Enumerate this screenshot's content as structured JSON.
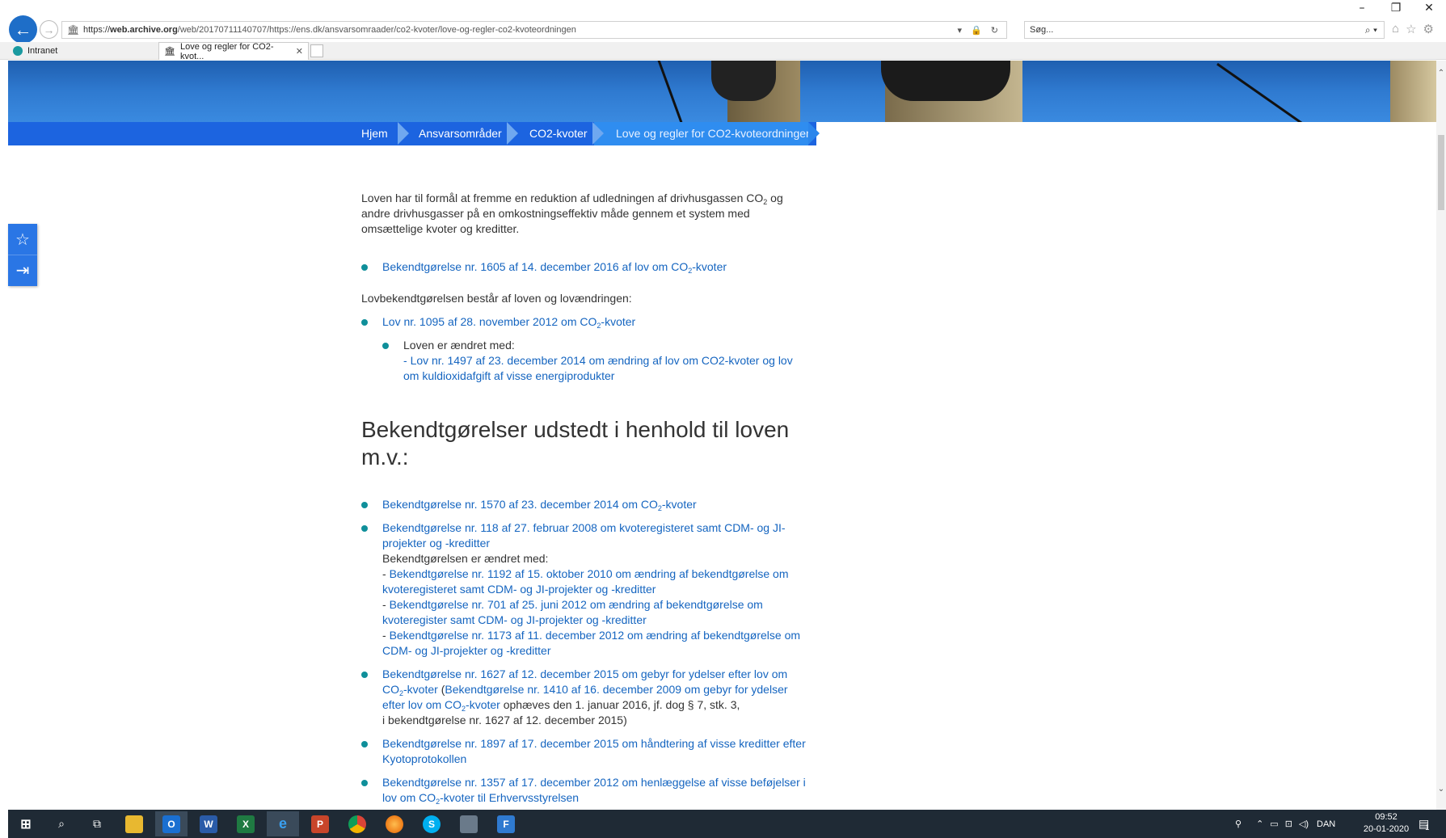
{
  "browser": {
    "url": "https://web.archive.org/web/20170711140707/https://ens.dk/ansvarsomraader/co2-kvoter/love-og-regler-co2-kvoteordningen",
    "url_host": "web.archive.org",
    "url_prefix": "https://",
    "url_rest": "/web/20170711140707/https://ens.dk/ansvarsomraader/co2-kvoter/love-og-regler-co2-kvoteordningen",
    "search_placeholder": "Søg...",
    "tabs": [
      {
        "label": "Intranet"
      },
      {
        "label": "Love og regler for CO2-kvot..."
      }
    ]
  },
  "breadcrumb": [
    {
      "label": "Hjem"
    },
    {
      "label": "Ansvarsområder"
    },
    {
      "label": "CO2-kvoter"
    },
    {
      "label": "Love og regler for CO2-kvoteordningen"
    }
  ],
  "content": {
    "intro_a": "Loven har til formål at fremme en reduktion af udledningen af drivhusgassen CO",
    "intro_b": " og andre drivhusgasser på en omkostningseffektiv måde gennem et system med omsættelige kvoter og kreditter.",
    "sub2": "2",
    "link1_a": "Bekendtgørelse nr. 1605 af 14. december 2016 af lov om CO",
    "link1_b": "-kvoter",
    "lovbek_text": "Lovbekendtgørelsen består af loven og lovændringen:",
    "link2_a": "Lov nr. 1095 af 28. november 2012 om CO",
    "link2_b": "-kvoter",
    "changed_label": "Loven er ændret med:",
    "dash": "- ",
    "link3": "Lov nr. 1497 af 23. december 2014 om ændring af lov om CO2-kvoter og lov om kuldioxidafgift af visse energiprodukter",
    "heading": "Bekendtgørelser udstedt i henhold til loven m.v.:",
    "b1_a": "Bekendtgørelse nr. 1570 af 23. december 2014 om CO",
    "b1_b": "-kvoter",
    "b2": "Bekendtgørelse nr. 118 af 27. februar 2008 om kvoteregisteret samt CDM- og JI-projekter og -kreditter",
    "b2_changed": "Bekendtgørelsen er ændret med:",
    "b2_c1": "Bekendtgørelse nr. 1192 af 15. oktober 2010 om ændring af bekendtgørelse om kvoteregisteret samt CDM- og JI-projekter og -kreditter",
    "b2_c2": "Bekendtgørelse nr. 701 af 25. juni 2012 om ændring af bekendtgørelse om kvoteregister samt CDM- og JI-projekter og -kreditter",
    "b2_c3": "Bekendtgørelse nr. 1173 af 11. december 2012 om ændring af bekendtgørelse om CDM- og JI-projekter og -kreditter",
    "b3_a": "Bekendtgørelse nr. 1627 af 12. december 2015 om gebyr for ydelser efter lov om CO",
    "b3_b": "-kvoter",
    "b3_paren_open": " (",
    "b3_c": "Bekendtgørelse nr. 1410 af 16. december 2009 om gebyr for ydelser efter lov om CO",
    "b3_d": "-kvoter",
    "b3_e": " ophæves den 1. januar 2016, jf. dog § 7, stk. 3,",
    "b3_f": "i bekendtgørelse nr. 1627 af 12. december 2015)",
    "b4": "Bekendtgørelse nr. 1897 af 17. december 2015 om håndtering af visse kreditter efter Kyotoprotokollen",
    "b5_a": "Bekendtgørelse nr. 1357 af 17. december 2012 om henlæggelse af visse beføjelser i lov om CO",
    "b5_b": "-kvoter til Erhvervsstyrelsen"
  },
  "taskbar": {
    "lang": "DAN",
    "time": "09:52",
    "date": "20-01-2020",
    "notifications": "1"
  },
  "colors": {
    "accent": "#1c64e0",
    "link": "#1565c0",
    "bullet": "#0f8f9a",
    "taskbar": "#1f2a35"
  }
}
